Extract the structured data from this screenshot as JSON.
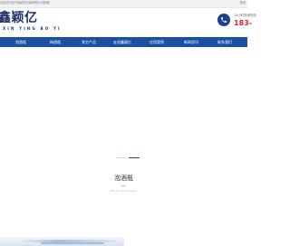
{
  "topbar": {
    "welcome": "欢迎访问嘉兴鑫颖亿包装有限公司官网！",
    "home": "首页"
  },
  "logo": {
    "cn": "鑫颖亿",
    "en": "XIN YING BO YI"
  },
  "hotline": {
    "label": "24小时咨询热线",
    "number": "183-"
  },
  "nav": {
    "items": [
      "泡酒瓶",
      "梅酒瓶",
      "其它产品",
      "走进鑫颖亿",
      "应用案例",
      "新闻资讯",
      "联系我们"
    ]
  },
  "section": {
    "title": "泡酒瓶",
    "subtitle": "Products display"
  },
  "colors": {
    "nav": "#1b4fa0",
    "brand": "#1b2f6d",
    "hotline": "#d92a2a"
  },
  "icons": {
    "phone": "phone-icon"
  }
}
